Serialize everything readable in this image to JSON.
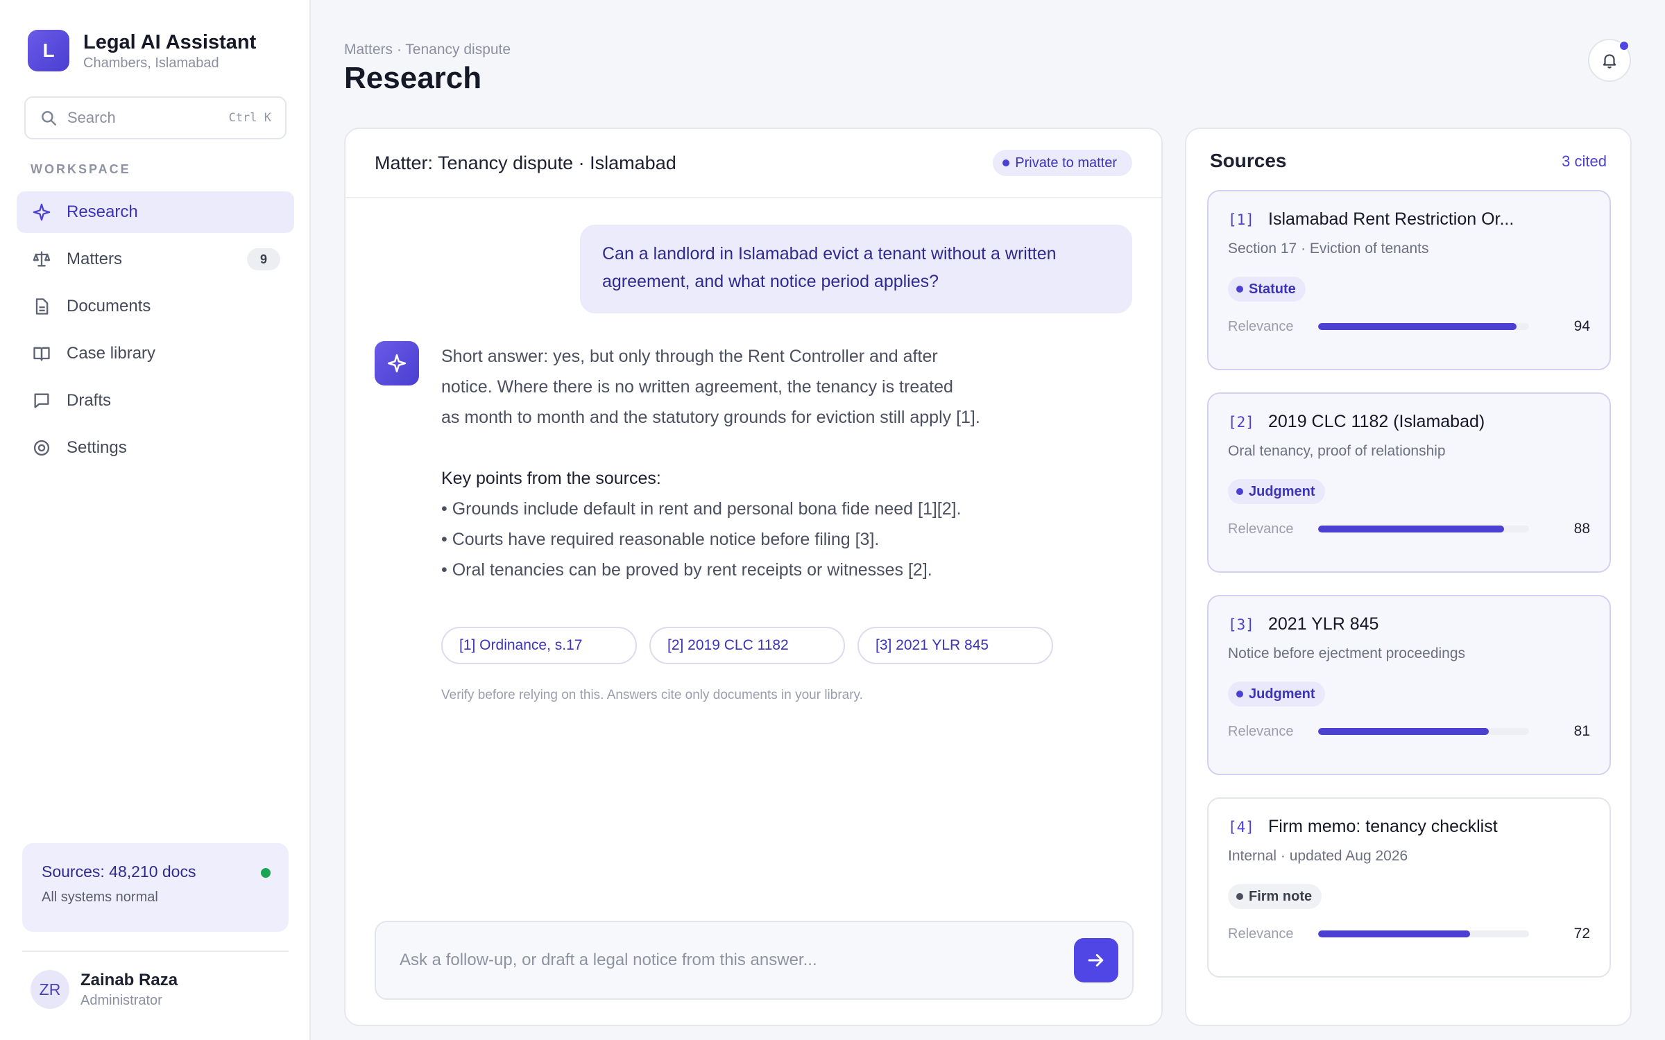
{
  "app": {
    "logo_letter": "L",
    "title": "Legal AI Assistant",
    "subtitle": "Chambers, Islamabad"
  },
  "search": {
    "placeholder": "Search",
    "shortcut": "Ctrl K"
  },
  "sidebar": {
    "section_label": "WORKSPACE",
    "items": [
      {
        "label": "Research",
        "icon": "sparkle-icon",
        "active": true
      },
      {
        "label": "Matters",
        "icon": "scale-icon",
        "badge": "9"
      },
      {
        "label": "Documents",
        "icon": "document-icon"
      },
      {
        "label": "Case library",
        "icon": "book-icon"
      },
      {
        "label": "Drafts",
        "icon": "chat-icon"
      },
      {
        "label": "Settings",
        "icon": "gear-icon"
      }
    ],
    "status": {
      "title": "Sources: 48,210 docs",
      "subtitle": "All systems normal",
      "dot_color": "#1aa554"
    },
    "user": {
      "initials": "ZR",
      "name": "Zainab Raza",
      "role": "Administrator"
    }
  },
  "header": {
    "breadcrumb": "Matters · Tenancy dispute",
    "title": "Research"
  },
  "chat": {
    "title": "Matter: Tenancy dispute · Islamabad",
    "privacy_badge": "Private to matter",
    "user_message_line1": "Can a landlord in Islamabad evict a tenant without a written",
    "user_message_line2": "agreement, and what notice period applies?",
    "answer_lines": [
      "Short answer: yes, but only through the Rent Controller and after",
      "notice. Where there is no written agreement, the tenancy is treated",
      "as month to month and the statutory grounds for eviction still apply [1]."
    ],
    "key_points_title": "Key points from the sources:",
    "key_points": [
      "• Grounds include default in rent and personal bona fide need [1][2].",
      "• Courts have required reasonable notice before filing [3].",
      "• Oral tenancies can be proved by rent receipts or witnesses [2]."
    ],
    "citations": [
      "[1] Ordinance, s.17",
      "[2] 2019 CLC 1182",
      "[3] 2021 YLR 845"
    ],
    "disclaimer": "Verify before relying on this. Answers cite only documents in your library.",
    "composer_placeholder": "Ask a follow-up, or draft a legal notice from this answer..."
  },
  "sources": {
    "title": "Sources",
    "count": "3 cited",
    "relevance_label": "Relevance",
    "items": [
      {
        "num": "[1]",
        "title": "Islamabad Rent Restriction Or...",
        "subtitle": "Section 17 · Eviction of tenants",
        "tag": "Statute",
        "relevance": 94,
        "cited": true
      },
      {
        "num": "[2]",
        "title": "2019 CLC 1182 (Islamabad)",
        "subtitle": "Oral tenancy, proof of relationship",
        "tag": "Judgment",
        "relevance": 88,
        "cited": true
      },
      {
        "num": "[3]",
        "title": "2021 YLR 845",
        "subtitle": "Notice before ejectment proceedings",
        "tag": "Judgment",
        "relevance": 81,
        "cited": true
      },
      {
        "num": "[4]",
        "title": "Firm memo: tenancy checklist",
        "subtitle": "Internal · updated Aug 2026",
        "tag": "Firm note",
        "relevance": 72,
        "cited": false
      }
    ]
  },
  "colors": {
    "accent": "#4f46e5",
    "accent_soft": "#ecebfb",
    "status_ok": "#1aa554"
  }
}
